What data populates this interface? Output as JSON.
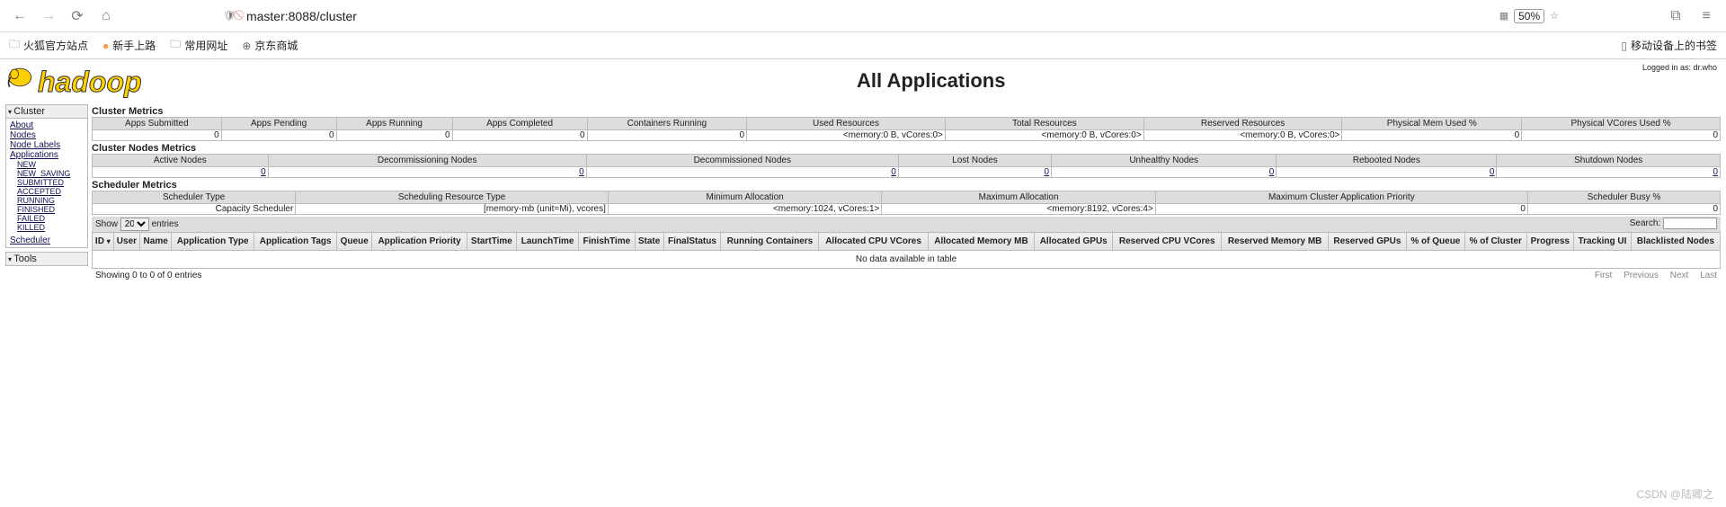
{
  "browser": {
    "url": "master:8088/cluster",
    "zoom": "50%"
  },
  "bookmarks": {
    "firefox": "火狐官方站点",
    "getstarted": "新手上路",
    "common": "常用网址",
    "jd": "京东商城",
    "mobile": "移动设备上的书签"
  },
  "page": {
    "title": "All Applications",
    "logged_in": "Logged in as: dr.who"
  },
  "sidebar": {
    "cluster": "Cluster",
    "about": "About",
    "nodes": "Nodes",
    "node_labels": "Node Labels",
    "applications": "Applications",
    "app_states": [
      "NEW",
      "NEW_SAVING",
      "SUBMITTED",
      "ACCEPTED",
      "RUNNING",
      "FINISHED",
      "FAILED",
      "KILLED"
    ],
    "scheduler": "Scheduler",
    "tools": "Tools"
  },
  "cluster_metrics": {
    "title": "Cluster Metrics",
    "headers": [
      "Apps Submitted",
      "Apps Pending",
      "Apps Running",
      "Apps Completed",
      "Containers Running",
      "Used Resources",
      "Total Resources",
      "Reserved Resources",
      "Physical Mem Used %",
      "Physical VCores Used %"
    ],
    "values": [
      "0",
      "0",
      "0",
      "0",
      "0",
      "<memory:0 B, vCores:0>",
      "<memory:0 B, vCores:0>",
      "<memory:0 B, vCores:0>",
      "0",
      "0"
    ]
  },
  "nodes_metrics": {
    "title": "Cluster Nodes Metrics",
    "headers": [
      "Active Nodes",
      "Decommissioning Nodes",
      "Decommissioned Nodes",
      "Lost Nodes",
      "Unhealthy Nodes",
      "Rebooted Nodes",
      "Shutdown Nodes"
    ],
    "values": [
      "0",
      "0",
      "0",
      "0",
      "0",
      "0",
      "0"
    ]
  },
  "scheduler_metrics": {
    "title": "Scheduler Metrics",
    "headers": [
      "Scheduler Type",
      "Scheduling Resource Type",
      "Minimum Allocation",
      "Maximum Allocation",
      "Maximum Cluster Application Priority",
      "Scheduler Busy %"
    ],
    "values": [
      "Capacity Scheduler",
      "[memory-mb (unit=Mi), vcores]",
      "<memory:1024, vCores:1>",
      "<memory:8192, vCores:4>",
      "0",
      "0"
    ]
  },
  "apps_table": {
    "show_label": "Show",
    "entries_label": "entries",
    "search_label": "Search:",
    "show_value": "20",
    "headers": [
      "ID",
      "User",
      "Name",
      "Application Type",
      "Application Tags",
      "Queue",
      "Application Priority",
      "StartTime",
      "LaunchTime",
      "FinishTime",
      "State",
      "FinalStatus",
      "Running Containers",
      "Allocated CPU VCores",
      "Allocated Memory MB",
      "Allocated GPUs",
      "Reserved CPU VCores",
      "Reserved Memory MB",
      "Reserved GPUs",
      "% of Queue",
      "% of Cluster",
      "Progress",
      "Tracking UI",
      "Blacklisted Nodes"
    ],
    "no_data": "No data available in table",
    "info": "Showing 0 to 0 of 0 entries",
    "pager": {
      "first": "First",
      "previous": "Previous",
      "next": "Next",
      "last": "Last"
    }
  },
  "watermark": "CSDN @陆卿之"
}
